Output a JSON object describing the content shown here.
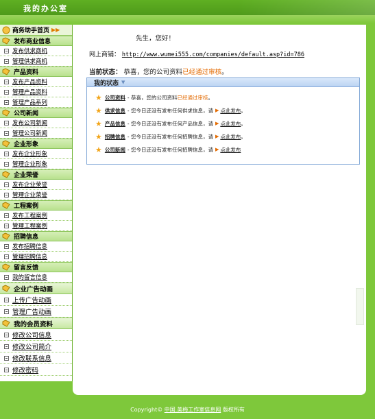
{
  "header": {
    "title": "我的办公室"
  },
  "sidebar": {
    "home": "商务助手首页",
    "sections": [
      {
        "title": "发布商业信息",
        "items": [
          "发布供求商机",
          "管理供求商机"
        ]
      },
      {
        "title": "产品资料",
        "items": [
          "发布产品资料",
          "管理产品资料",
          "管理产品系列"
        ]
      },
      {
        "title": "公司新闻",
        "items": [
          "发布公司新闻",
          "管理公司新闻"
        ]
      },
      {
        "title": "企业形象",
        "items": [
          "发布企业形象",
          "管理企业形象"
        ]
      },
      {
        "title": "企业荣誉",
        "items": [
          "发布企业荣誉",
          "管理企业荣誉"
        ]
      },
      {
        "title": "工程案例",
        "items": [
          "发布工程案例",
          "管理工程案例"
        ]
      },
      {
        "title": "招聘信息",
        "items": [
          "发布招聘信息",
          "管理招聘信息"
        ]
      },
      {
        "title": "留言反馈",
        "items": [
          "我的留言信息"
        ]
      }
    ],
    "ad_section": {
      "title": "企业广告动画",
      "items": [
        "上传广告动画",
        "管理广告动画"
      ]
    },
    "member_section": {
      "title": "我的会员资料",
      "items": [
        "修改公司信息",
        "修改公司简介",
        "修改联系信息",
        "修改密码"
      ]
    }
  },
  "main": {
    "greeting": "先生，您好！",
    "shop_label": "网上商铺：",
    "shop_url": "http://www.wumei555.com/companies/default.asp?id=786",
    "status_label": "当前状态：",
    "status_text": "恭喜，您的公司资料",
    "status_ok": "已经通过审核",
    "status_end": "。",
    "panel_title": "我的状态",
    "rows": [
      {
        "key": "公司资料",
        "text": " - 恭喜，您的公司资料",
        "highlight": "已经通过审核",
        "end": "。",
        "link": ""
      },
      {
        "key": "供求信息",
        "text": " - 您今日还没有发布任何供求信息，请",
        "highlight": "",
        "end": "。",
        "link": "点此发布"
      },
      {
        "key": "产品信息",
        "text": " - 您今日还没有发布任何产品信息，请",
        "highlight": "",
        "end": "。",
        "link": "点此发布"
      },
      {
        "key": "招聘信息",
        "text": " - 您今日还没有发布任何招聘信息，请",
        "highlight": "",
        "end": "。",
        "link": "点此发布"
      },
      {
        "key": "公司新闻",
        "text": " - 您今日还没有发布任何招聘信息，请",
        "highlight": "",
        "end": "",
        "link": "点此发布"
      }
    ]
  },
  "footer": {
    "prefix": "Copyright© ",
    "link": "中国.美梅工作室信息网",
    "suffix": " 版权所有"
  },
  "colors": {
    "green": "#7ec83b",
    "accent": "#e36a00",
    "panel_border": "#7fa6d6"
  }
}
